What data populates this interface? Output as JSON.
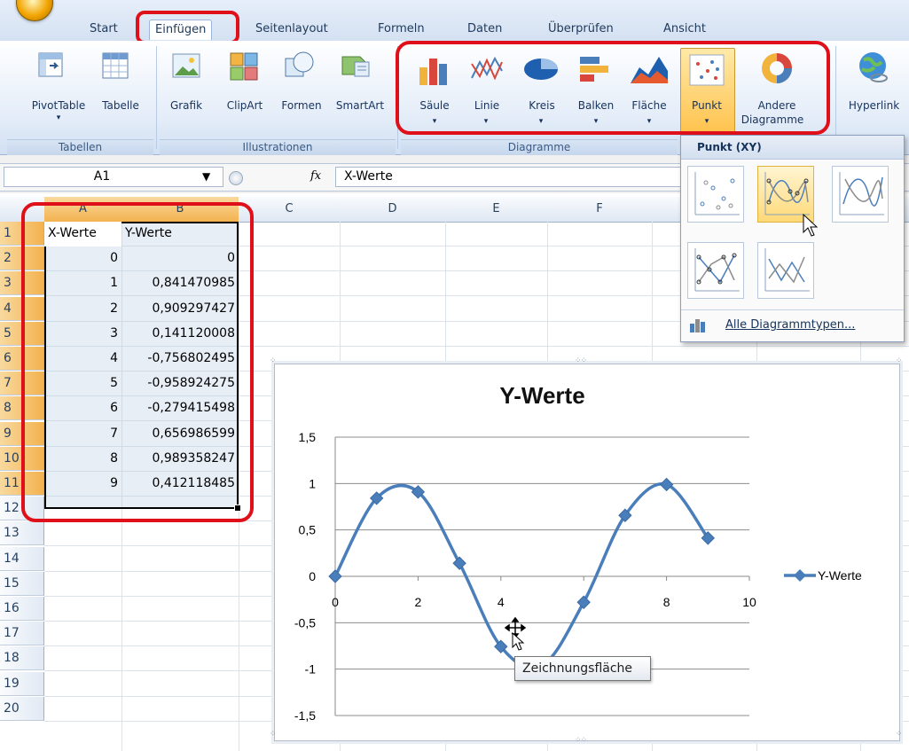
{
  "ribbon": {
    "tabs": [
      "Start",
      "Einfügen",
      "Seitenlayout",
      "Formeln",
      "Daten",
      "Überprüfen",
      "Ansicht"
    ],
    "active_tab": "Einfügen",
    "groups": {
      "tabellen": {
        "label": "Tabellen",
        "buttons": [
          "PivotTable",
          "Tabelle"
        ]
      },
      "illustrationen": {
        "label": "Illustrationen",
        "buttons": [
          "Grafik",
          "ClipArt",
          "Formen",
          "SmartArt"
        ]
      },
      "diagramme": {
        "label": "Diagramme",
        "buttons": [
          "Säule",
          "Linie",
          "Kreis",
          "Balken",
          "Fläche",
          "Punkt"
        ],
        "other_line1": "Andere",
        "other_line2": "Diagramme"
      },
      "links": {
        "buttons": [
          "Hyperlink"
        ]
      }
    }
  },
  "formula_bar": {
    "name_box": "A1",
    "fx": "fx",
    "content": "X-Werte"
  },
  "sheet": {
    "columns": [
      "A",
      "B",
      "C",
      "D",
      "E",
      "F"
    ],
    "rows": [
      "1",
      "2",
      "3",
      "4",
      "5",
      "6",
      "7",
      "8",
      "9",
      "10",
      "11",
      "12",
      "13",
      "14",
      "15",
      "16",
      "17",
      "18",
      "19",
      "20"
    ],
    "headers": {
      "a": "X-Werte",
      "b": "Y-Werte"
    },
    "data": [
      {
        "x": "0",
        "y": "0"
      },
      {
        "x": "1",
        "y": "0,841470985"
      },
      {
        "x": "2",
        "y": "0,909297427"
      },
      {
        "x": "3",
        "y": "0,141120008"
      },
      {
        "x": "4",
        "y": "-0,756802495"
      },
      {
        "x": "5",
        "y": "-0,958924275"
      },
      {
        "x": "6",
        "y": "-0,279415498"
      },
      {
        "x": "7",
        "y": "0,656986599"
      },
      {
        "x": "8",
        "y": "0,989358247"
      },
      {
        "x": "9",
        "y": "0,412118485"
      }
    ]
  },
  "dropdown": {
    "title": "Punkt (XY)",
    "all_types": "Alle Diagrammtypen..."
  },
  "tooltip": "Zeichnungsfläche",
  "colors": {
    "series": "#4a7ebb",
    "highlight": "#e0101a",
    "selection": "#f3b24f"
  },
  "chart_data": {
    "type": "scatter",
    "title": "Y-Werte",
    "series": [
      {
        "name": "Y-Werte",
        "x": [
          0,
          1,
          2,
          3,
          4,
          5,
          6,
          7,
          8,
          9
        ],
        "y": [
          0,
          0.841470985,
          0.909297427,
          0.141120008,
          -0.756802495,
          -0.958924275,
          -0.279415498,
          0.656986599,
          0.989358247,
          0.412118485
        ]
      }
    ],
    "xlim": [
      0,
      10
    ],
    "ylim": [
      -1.5,
      1.5
    ],
    "xticks": [
      "0",
      "2",
      "4",
      "6",
      "8",
      "10"
    ],
    "yticks": [
      "-1,5",
      "-1",
      "-0,5",
      "0",
      "0,5",
      "1",
      "1,5"
    ],
    "grid": "horizontal",
    "legend": "right",
    "smooth": true
  }
}
